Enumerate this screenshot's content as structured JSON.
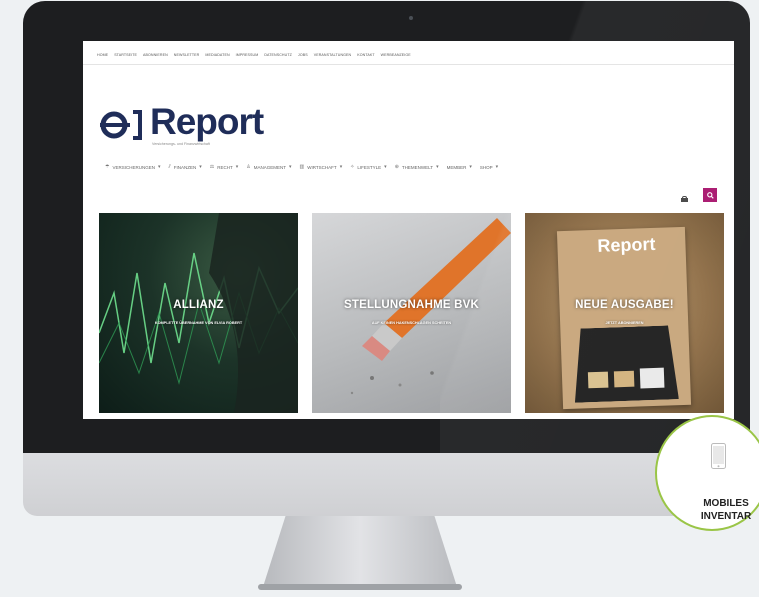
{
  "site": {
    "top_nav": [
      "Home",
      "Startseite",
      "Abonnieren",
      "Newsletter",
      "Mediadaten",
      "Impressum",
      "Datenschutz",
      "Jobs",
      "Veranstaltungen",
      "Kontakt",
      "Werbeanzeige"
    ],
    "logo": {
      "text": "Report",
      "tagline": "Versicherungs- und Finanzwirtschaft"
    },
    "main_nav": [
      {
        "icon": "umbrella-icon",
        "label": "Versicherungen",
        "glyph": "☂"
      },
      {
        "icon": "chart-icon",
        "label": "Finanzen",
        "glyph": "⫽"
      },
      {
        "icon": "scale-icon",
        "label": "Recht",
        "glyph": "⚖"
      },
      {
        "icon": "person-icon",
        "label": "Management",
        "glyph": "♙"
      },
      {
        "icon": "bars-icon",
        "label": "Wirtschaft",
        "glyph": "▥"
      },
      {
        "icon": "glass-icon",
        "label": "Lifestyle",
        "glyph": "✧"
      },
      {
        "icon": "globe-icon",
        "label": "Themenwelt",
        "glyph": "⊕"
      },
      {
        "icon": "",
        "label": "Member",
        "glyph": ""
      },
      {
        "icon": "",
        "label": "Shop",
        "glyph": ""
      }
    ]
  },
  "tiles": [
    {
      "title": "ALLIANZ",
      "subtitle": "KOMPLETTE ÜBERNAHME VON ELVIA ROBERT"
    },
    {
      "title": "STELLUNGNAHME BVK",
      "subtitle": "AUF KEINEN HAKENSCHLAGEN SCHEITEN"
    },
    {
      "title": "NEUE AUSGABE!",
      "subtitle": "JETZT ABONNIEREN"
    }
  ],
  "magazine_cover": {
    "text": "Report"
  },
  "badge": {
    "line1": "MOBILES",
    "line2": "INVENTAR"
  },
  "colors": {
    "brand_navy": "#1f2d59",
    "accent_magenta": "#a7146d",
    "badge_green": "#9ac547"
  }
}
